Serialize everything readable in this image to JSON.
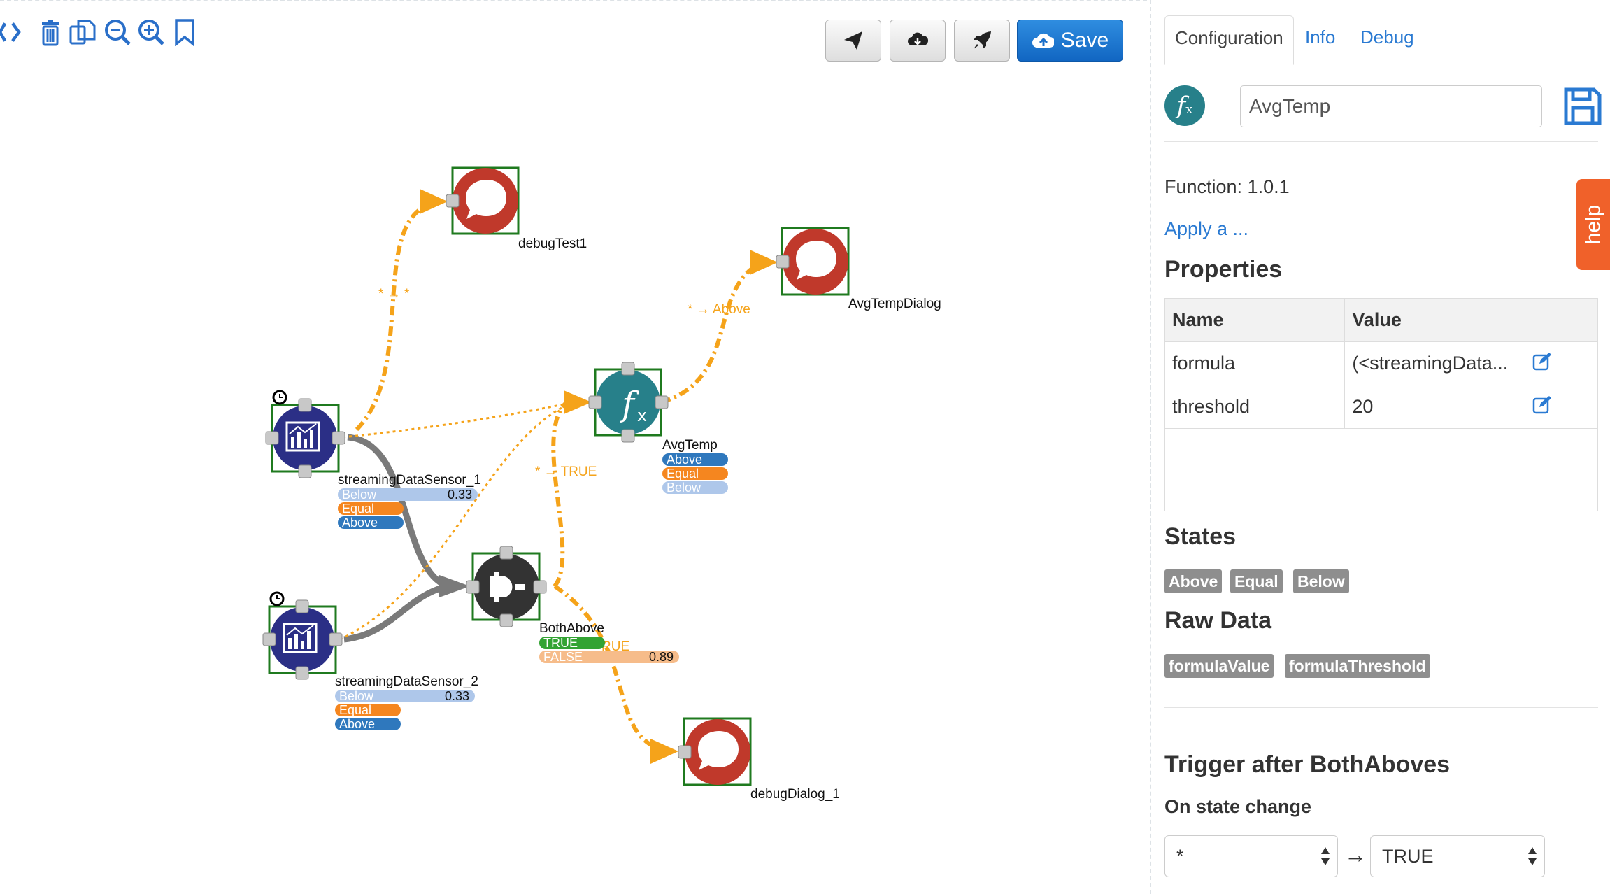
{
  "toolbar": {
    "icons": [
      "expand-icon",
      "trash-icon",
      "copy-icon",
      "zoom-out-icon",
      "zoom-in-icon",
      "bookmark-icon"
    ],
    "buttons": [
      "send-icon",
      "cloud-download-icon",
      "rocket-icon"
    ],
    "save_label": "Save"
  },
  "graph": {
    "nodes": {
      "debugTest1": "debugTest1",
      "avgTempDialog": "AvgTempDialog",
      "avgTemp": "AvgTemp",
      "sensor1": "streamingDataSensor_1",
      "sensor2": "streamingDataSensor_2",
      "bothAbove": "BothAbove",
      "debugDialog1": "debugDialog_1"
    },
    "edge_labels": {
      "sensor_to_debug": "* → *",
      "avgtemp_to_dialog": "* → Above",
      "bothabove_to_avgtemp": "* → TRUE",
      "bothabove_overlap": "RUE"
    },
    "states": {
      "sensor1": [
        {
          "label": "Below",
          "color": "#aec7ea",
          "value": "0.33"
        },
        {
          "label": "Equal",
          "color": "#f5861f"
        },
        {
          "label": "Above",
          "color": "#2f78bd"
        }
      ],
      "sensor2": [
        {
          "label": "Below",
          "color": "#aec7ea",
          "value": "0.33"
        },
        {
          "label": "Equal",
          "color": "#f5861f"
        },
        {
          "label": "Above",
          "color": "#2f78bd"
        }
      ],
      "avgTemp": [
        {
          "label": "Above",
          "color": "#2f78bd"
        },
        {
          "label": "Equal",
          "color": "#f5861f"
        },
        {
          "label": "Below",
          "color": "#aec7ea"
        }
      ],
      "bothAbove": [
        {
          "label": "TRUE",
          "color": "#33a333"
        },
        {
          "label": "FALSE",
          "color": "#f6bc8a",
          "value": "0.89"
        }
      ]
    }
  },
  "panel": {
    "tabs": [
      "Configuration",
      "Info",
      "Debug"
    ],
    "active_tab": "Configuration",
    "node_icon": "fx-icon",
    "node_name": "AvgTemp",
    "function_version": "Function: 1.0.1",
    "apply_link": "Apply a ...",
    "properties_title": "Properties",
    "properties_headers": [
      "Name",
      "Value",
      ""
    ],
    "properties": [
      {
        "name": "formula",
        "value": "(<streamingData..."
      },
      {
        "name": "threshold",
        "value": "20"
      }
    ],
    "states_title": "States",
    "states": [
      "Above",
      "Equal",
      "Below"
    ],
    "raw_data_title": "Raw Data",
    "raw_data": [
      "formulaValue",
      "formulaThreshold"
    ],
    "trigger_title": "Trigger after BothAboves",
    "trigger_subtitle": "On state change",
    "from_state": "*",
    "arrow": "→",
    "to_state": "TRUE",
    "help_label": "help"
  },
  "colors": {
    "accent": "#2a7ad2",
    "save_button": "#1e7bd6",
    "edge": "#f5a31a",
    "node_border": "#1f7a1f",
    "debug_node": "#c0392b",
    "sensor_node": "#2b2f86",
    "function_node": "#27808a",
    "logic_node": "#333333",
    "help_tab": "#f0612a",
    "tag_gray": "#8e8e8e"
  }
}
